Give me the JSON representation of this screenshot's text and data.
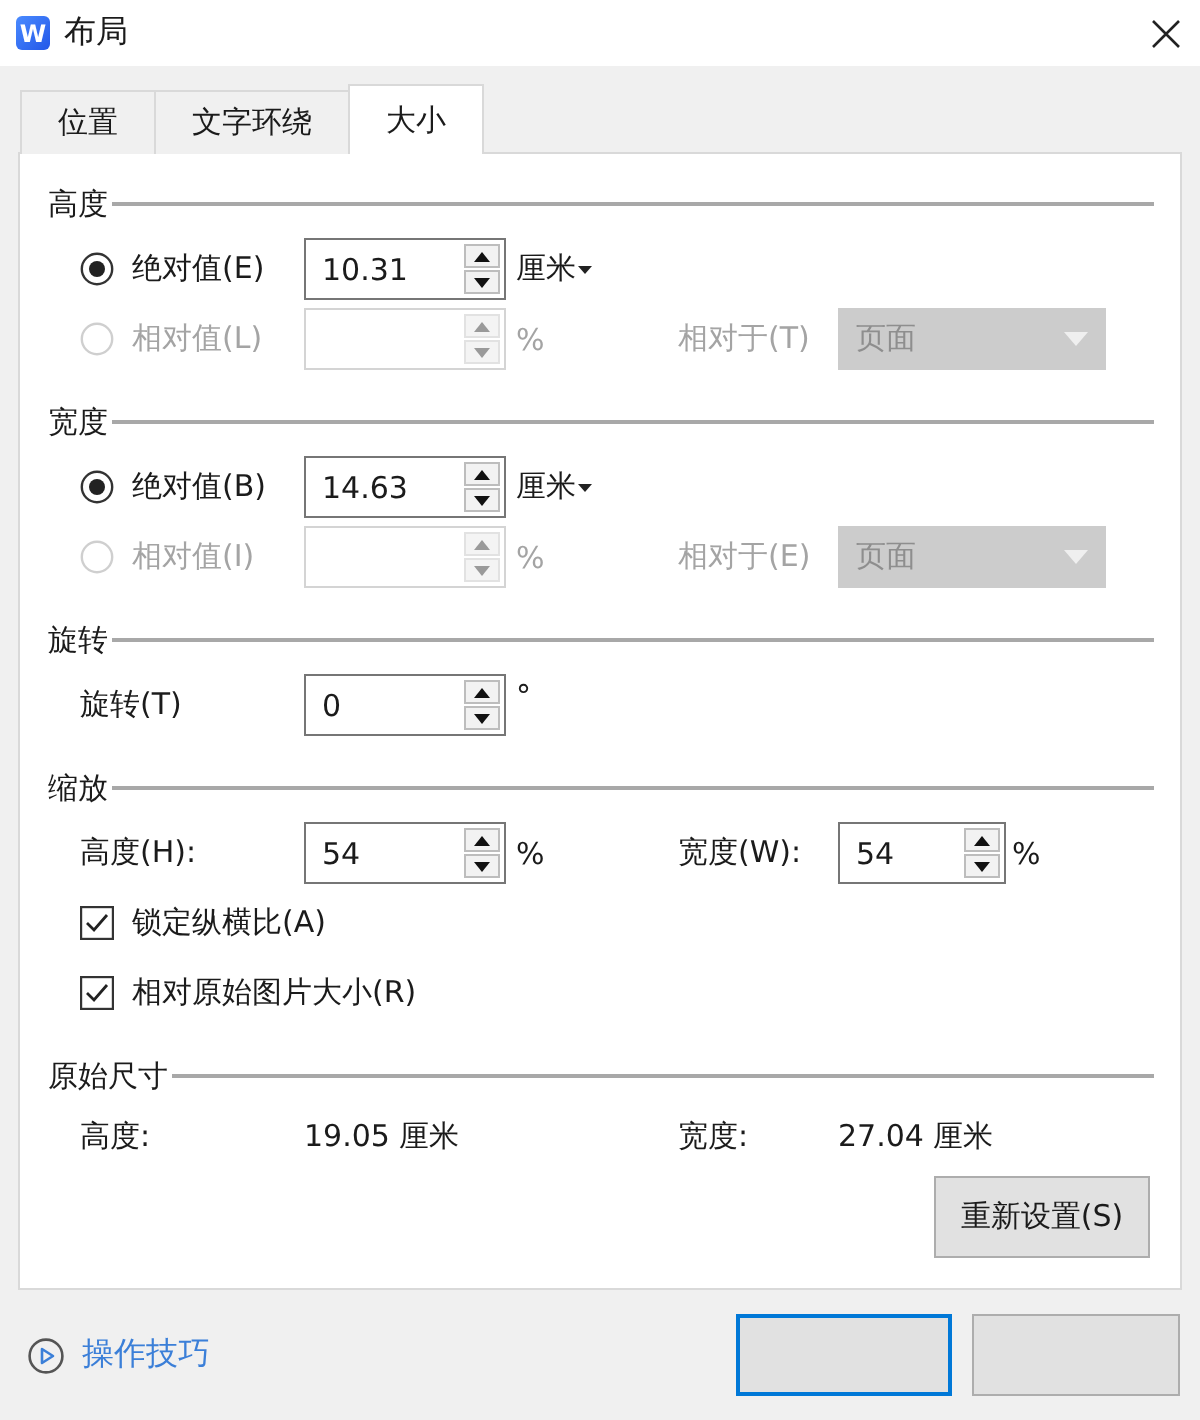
{
  "window": {
    "icon_letter": "W",
    "title": "布局"
  },
  "tabs": [
    {
      "label": "位置",
      "selected": false
    },
    {
      "label": "文字环绕",
      "selected": false
    },
    {
      "label": "大小",
      "selected": true
    }
  ],
  "sections": [
    {
      "title": "高度",
      "rows": [
        {
          "kind": "radio",
          "label": "绝对值(E)",
          "selected": true,
          "disabled": false,
          "value": "10.31",
          "unit": "厘米",
          "unit_menu": true
        },
        {
          "kind": "radio",
          "label": "相对值(L)",
          "selected": false,
          "disabled": true,
          "unit": "%",
          "unit_menu": false,
          "relative_label": "相对于(T)",
          "relative_value": "页面"
        }
      ]
    },
    {
      "title": "宽度",
      "rows": [
        {
          "kind": "radio",
          "label": "绝对值(B)",
          "selected": true,
          "disabled": false,
          "value": "14.63",
          "unit": "厘米",
          "unit_menu": true
        },
        {
          "kind": "radio",
          "label": "相对值(I)",
          "selected": false,
          "disabled": true,
          "unit": "%",
          "unit_menu": false,
          "relative_label": "相对于(E)",
          "relative_value": "页面"
        }
      ]
    },
    {
      "title": "旋转",
      "rows": [
        {
          "kind": "field",
          "label": "旋转(T)",
          "value": "0",
          "unit": "°"
        }
      ]
    },
    {
      "title": "缩放",
      "rows": [
        {
          "kind": "pair",
          "items": [
            {
              "label": "高度(H):",
              "value": "54",
              "unit": "%"
            },
            {
              "label": "宽度(W):",
              "value": "54",
              "unit": "%"
            }
          ]
        },
        {
          "kind": "checkbox",
          "label": "锁定纵横比(A)",
          "checked": true
        },
        {
          "kind": "checkbox",
          "label": "相对原始图片大小(R)",
          "checked": true
        }
      ]
    },
    {
      "title": "原始尺寸",
      "rows": [
        {
          "kind": "readout",
          "items": [
            {
              "label": "高度:",
              "value": "19.05 厘米"
            },
            {
              "label": "宽度:",
              "value": "27.04 厘米"
            }
          ]
        }
      ]
    }
  ],
  "reset_button": {
    "label": "重新设置(S)"
  },
  "footer": {
    "tips_link": "操作技巧",
    "buttons": [
      {
        "focused": true
      },
      {
        "focused": false
      }
    ]
  }
}
